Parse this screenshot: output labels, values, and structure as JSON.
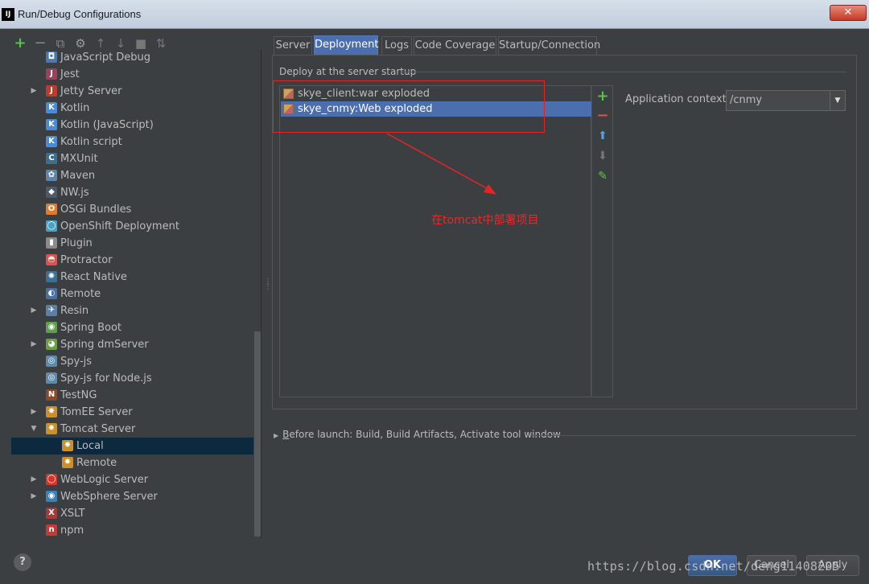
{
  "window": {
    "app_icon": "IJ",
    "title": "Run/Debug Configurations",
    "close_label": "✕"
  },
  "toolbar": {
    "add": "+",
    "remove": "−",
    "copy": "⧉",
    "edit": "⚙",
    "up": "↑",
    "down": "↓",
    "folder": "■",
    "sort": "⇅"
  },
  "tree": {
    "items": [
      {
        "label": "JavaScript Debug",
        "icon": "js-debug-icon",
        "glyph": "◘",
        "color": "#4a78b0",
        "expandable": false
      },
      {
        "label": "Jest",
        "icon": "jest-icon",
        "glyph": "J",
        "color": "#99425b",
        "expandable": false
      },
      {
        "label": "Jetty Server",
        "icon": "jetty-icon",
        "glyph": "J",
        "color": "#c0392b",
        "expandable": true
      },
      {
        "label": "Kotlin",
        "icon": "kotlin-icon",
        "glyph": "K",
        "color": "#4b8bd6",
        "expandable": false
      },
      {
        "label": "Kotlin (JavaScript)",
        "icon": "kotlin-js-icon",
        "glyph": "K",
        "color": "#4b8bd6",
        "expandable": false
      },
      {
        "label": "Kotlin script",
        "icon": "kotlin-script-icon",
        "glyph": "K",
        "color": "#4b8bd6",
        "expandable": false
      },
      {
        "label": "MXUnit",
        "icon": "mxunit-icon",
        "glyph": "C",
        "color": "#3b6e8f",
        "expandable": false
      },
      {
        "label": "Maven",
        "icon": "maven-icon",
        "glyph": "✿",
        "color": "#5e86a8",
        "expandable": false
      },
      {
        "label": "NW.js",
        "icon": "nwjs-icon",
        "glyph": "◆",
        "color": "#4c5a6b",
        "expandable": false
      },
      {
        "label": "OSGi Bundles",
        "icon": "osgi-icon",
        "glyph": "O",
        "color": "#e07b2a",
        "expandable": false
      },
      {
        "label": "OpenShift Deployment",
        "icon": "openshift-icon",
        "glyph": "◯",
        "color": "#4aa1c8",
        "expandable": false
      },
      {
        "label": "Plugin",
        "icon": "plugin-icon",
        "glyph": "▮",
        "color": "#8b8b8b",
        "expandable": false
      },
      {
        "label": "Protractor",
        "icon": "protractor-icon",
        "glyph": "◓",
        "color": "#d9534f",
        "expandable": false
      },
      {
        "label": "React Native",
        "icon": "react-icon",
        "glyph": "✺",
        "color": "#3d6f93",
        "expandable": false
      },
      {
        "label": "Remote",
        "icon": "remote-icon",
        "glyph": "◐",
        "color": "#4a6fa0",
        "expandable": false
      },
      {
        "label": "Resin",
        "icon": "resin-icon",
        "glyph": "✈",
        "color": "#5c7fa3",
        "expandable": true
      },
      {
        "label": "Spring Boot",
        "icon": "spring-boot-icon",
        "glyph": "◉",
        "color": "#5fa04e",
        "expandable": false
      },
      {
        "label": "Spring dmServer",
        "icon": "spring-dm-icon",
        "glyph": "◕",
        "color": "#6ba046",
        "expandable": true
      },
      {
        "label": "Spy-js",
        "icon": "spyjs-icon",
        "glyph": "◎",
        "color": "#5f8aa8",
        "expandable": false
      },
      {
        "label": "Spy-js for Node.js",
        "icon": "spyjs-node-icon",
        "glyph": "◎",
        "color": "#5f8aa8",
        "expandable": false
      },
      {
        "label": "TestNG",
        "icon": "testng-icon",
        "glyph": "N",
        "color": "#8a4a2a",
        "expandable": false
      },
      {
        "label": "TomEE Server",
        "icon": "tomee-icon",
        "glyph": "✸",
        "color": "#c9902b",
        "expandable": true
      },
      {
        "label": "Tomcat Server",
        "icon": "tomcat-icon",
        "glyph": "✸",
        "color": "#c9902b",
        "expandable": true,
        "expanded": true
      },
      {
        "label": "Local",
        "icon": "tomcat-local-icon",
        "glyph": "✸",
        "color": "#c9902b",
        "expandable": false,
        "child": true,
        "selected": true
      },
      {
        "label": "Remote",
        "icon": "tomcat-remote-icon",
        "glyph": "✸",
        "color": "#c9902b",
        "expandable": false,
        "child": true
      },
      {
        "label": "WebLogic Server",
        "icon": "weblogic-icon",
        "glyph": "◯",
        "color": "#d8352a",
        "expandable": true
      },
      {
        "label": "WebSphere Server",
        "icon": "websphere-icon",
        "glyph": "◉",
        "color": "#3d7fb7",
        "expandable": true
      },
      {
        "label": "XSLT",
        "icon": "xslt-icon",
        "glyph": "X",
        "color": "#a33b3b",
        "expandable": false
      },
      {
        "label": "npm",
        "icon": "npm-icon",
        "glyph": "n",
        "color": "#c23b34",
        "expandable": false
      }
    ]
  },
  "tabs": [
    "Server",
    "Deployment",
    "Logs",
    "Code Coverage",
    "Startup/Connection"
  ],
  "active_tab": "Deployment",
  "deployment": {
    "section_label": "Deploy at the server startup",
    "artifacts": [
      {
        "label": "skye_client:war exploded",
        "selected": false
      },
      {
        "label": "skye_cnmy:Web exploded",
        "selected": true
      }
    ],
    "tools": {
      "add": "+",
      "remove": "−",
      "up": "⬆",
      "down": "⬇",
      "edit": "✎"
    },
    "context_label": "Application context:",
    "context_value": "/cnmy"
  },
  "annotation": {
    "text": "在tomcat中部署项目",
    "color": "#e42424"
  },
  "before_launch": {
    "prefix": "B",
    "text": "efore launch: Build, Build Artifacts, Activate tool window"
  },
  "buttons": {
    "help": "?",
    "ok": "OK",
    "cancel": "Cancel",
    "apply": "Apply"
  },
  "watermark": "https://blog.csdn.net/deng11408205"
}
